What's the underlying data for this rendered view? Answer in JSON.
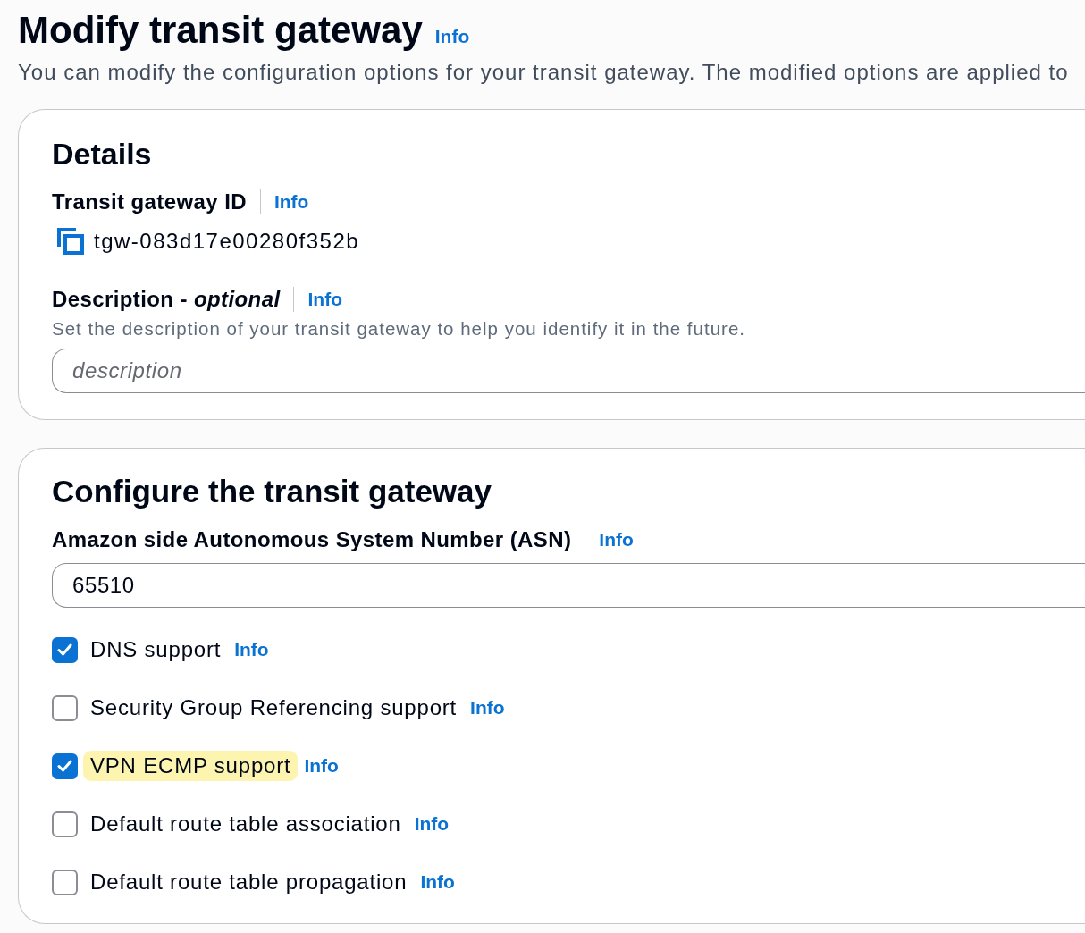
{
  "header": {
    "title": "Modify transit gateway",
    "info_link": "Info",
    "description": "You can modify the configuration options for your transit gateway. The modified options are applied to"
  },
  "details": {
    "heading": "Details",
    "gateway_id": {
      "label": "Transit gateway ID",
      "info_link": "Info",
      "value": "tgw-083d17e00280f352b"
    },
    "description_field": {
      "label": "Description - *optional*",
      "info_link": "Info",
      "hint": "Set the description of your transit gateway to help you identify it in the future.",
      "placeholder": "description"
    }
  },
  "configure": {
    "heading": "Configure the transit gateway",
    "asn_field": {
      "label": "Amazon side Autonomous System Number (ASN)",
      "info_link": "Info",
      "value": "65510"
    },
    "options": [
      {
        "label": "DNS support",
        "info_link": "Info",
        "checked": true,
        "highlighted": false
      },
      {
        "label": "Security Group Referencing support",
        "info_link": "Info",
        "checked": false,
        "highlighted": false
      },
      {
        "label": "VPN ECMP support",
        "info_link": "Info",
        "checked": true,
        "highlighted": true
      },
      {
        "label": "Default route table association",
        "info_link": "Info",
        "checked": false,
        "highlighted": false
      },
      {
        "label": "Default route table propagation",
        "info_link": "Info",
        "checked": false,
        "highlighted": false
      }
    ]
  }
}
